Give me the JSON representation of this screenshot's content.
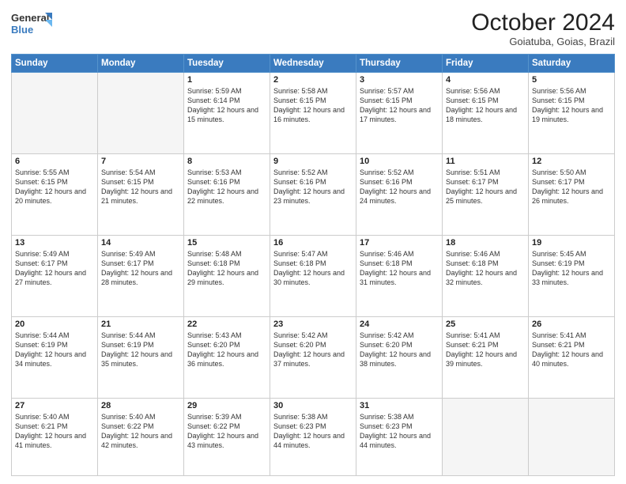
{
  "header": {
    "logo_line1": "General",
    "logo_line2": "Blue",
    "month": "October 2024",
    "location": "Goiatuba, Goias, Brazil"
  },
  "weekdays": [
    "Sunday",
    "Monday",
    "Tuesday",
    "Wednesday",
    "Thursday",
    "Friday",
    "Saturday"
  ],
  "weeks": [
    [
      {
        "day": "",
        "empty": true
      },
      {
        "day": "",
        "empty": true
      },
      {
        "day": "1",
        "sunrise": "5:59 AM",
        "sunset": "6:14 PM",
        "daylight": "12 hours and 15 minutes."
      },
      {
        "day": "2",
        "sunrise": "5:58 AM",
        "sunset": "6:15 PM",
        "daylight": "12 hours and 16 minutes."
      },
      {
        "day": "3",
        "sunrise": "5:57 AM",
        "sunset": "6:15 PM",
        "daylight": "12 hours and 17 minutes."
      },
      {
        "day": "4",
        "sunrise": "5:56 AM",
        "sunset": "6:15 PM",
        "daylight": "12 hours and 18 minutes."
      },
      {
        "day": "5",
        "sunrise": "5:56 AM",
        "sunset": "6:15 PM",
        "daylight": "12 hours and 19 minutes."
      }
    ],
    [
      {
        "day": "6",
        "sunrise": "5:55 AM",
        "sunset": "6:15 PM",
        "daylight": "12 hours and 20 minutes."
      },
      {
        "day": "7",
        "sunrise": "5:54 AM",
        "sunset": "6:15 PM",
        "daylight": "12 hours and 21 minutes."
      },
      {
        "day": "8",
        "sunrise": "5:53 AM",
        "sunset": "6:16 PM",
        "daylight": "12 hours and 22 minutes."
      },
      {
        "day": "9",
        "sunrise": "5:52 AM",
        "sunset": "6:16 PM",
        "daylight": "12 hours and 23 minutes."
      },
      {
        "day": "10",
        "sunrise": "5:52 AM",
        "sunset": "6:16 PM",
        "daylight": "12 hours and 24 minutes."
      },
      {
        "day": "11",
        "sunrise": "5:51 AM",
        "sunset": "6:17 PM",
        "daylight": "12 hours and 25 minutes."
      },
      {
        "day": "12",
        "sunrise": "5:50 AM",
        "sunset": "6:17 PM",
        "daylight": "12 hours and 26 minutes."
      }
    ],
    [
      {
        "day": "13",
        "sunrise": "5:49 AM",
        "sunset": "6:17 PM",
        "daylight": "12 hours and 27 minutes."
      },
      {
        "day": "14",
        "sunrise": "5:49 AM",
        "sunset": "6:17 PM",
        "daylight": "12 hours and 28 minutes."
      },
      {
        "day": "15",
        "sunrise": "5:48 AM",
        "sunset": "6:18 PM",
        "daylight": "12 hours and 29 minutes."
      },
      {
        "day": "16",
        "sunrise": "5:47 AM",
        "sunset": "6:18 PM",
        "daylight": "12 hours and 30 minutes."
      },
      {
        "day": "17",
        "sunrise": "5:46 AM",
        "sunset": "6:18 PM",
        "daylight": "12 hours and 31 minutes."
      },
      {
        "day": "18",
        "sunrise": "5:46 AM",
        "sunset": "6:18 PM",
        "daylight": "12 hours and 32 minutes."
      },
      {
        "day": "19",
        "sunrise": "5:45 AM",
        "sunset": "6:19 PM",
        "daylight": "12 hours and 33 minutes."
      }
    ],
    [
      {
        "day": "20",
        "sunrise": "5:44 AM",
        "sunset": "6:19 PM",
        "daylight": "12 hours and 34 minutes."
      },
      {
        "day": "21",
        "sunrise": "5:44 AM",
        "sunset": "6:19 PM",
        "daylight": "12 hours and 35 minutes."
      },
      {
        "day": "22",
        "sunrise": "5:43 AM",
        "sunset": "6:20 PM",
        "daylight": "12 hours and 36 minutes."
      },
      {
        "day": "23",
        "sunrise": "5:42 AM",
        "sunset": "6:20 PM",
        "daylight": "12 hours and 37 minutes."
      },
      {
        "day": "24",
        "sunrise": "5:42 AM",
        "sunset": "6:20 PM",
        "daylight": "12 hours and 38 minutes."
      },
      {
        "day": "25",
        "sunrise": "5:41 AM",
        "sunset": "6:21 PM",
        "daylight": "12 hours and 39 minutes."
      },
      {
        "day": "26",
        "sunrise": "5:41 AM",
        "sunset": "6:21 PM",
        "daylight": "12 hours and 40 minutes."
      }
    ],
    [
      {
        "day": "27",
        "sunrise": "5:40 AM",
        "sunset": "6:21 PM",
        "daylight": "12 hours and 41 minutes."
      },
      {
        "day": "28",
        "sunrise": "5:40 AM",
        "sunset": "6:22 PM",
        "daylight": "12 hours and 42 minutes."
      },
      {
        "day": "29",
        "sunrise": "5:39 AM",
        "sunset": "6:22 PM",
        "daylight": "12 hours and 43 minutes."
      },
      {
        "day": "30",
        "sunrise": "5:38 AM",
        "sunset": "6:23 PM",
        "daylight": "12 hours and 44 minutes."
      },
      {
        "day": "31",
        "sunrise": "5:38 AM",
        "sunset": "6:23 PM",
        "daylight": "12 hours and 44 minutes."
      },
      {
        "day": "",
        "empty": true
      },
      {
        "day": "",
        "empty": true
      }
    ]
  ],
  "accent_color": "#3a7bbf"
}
